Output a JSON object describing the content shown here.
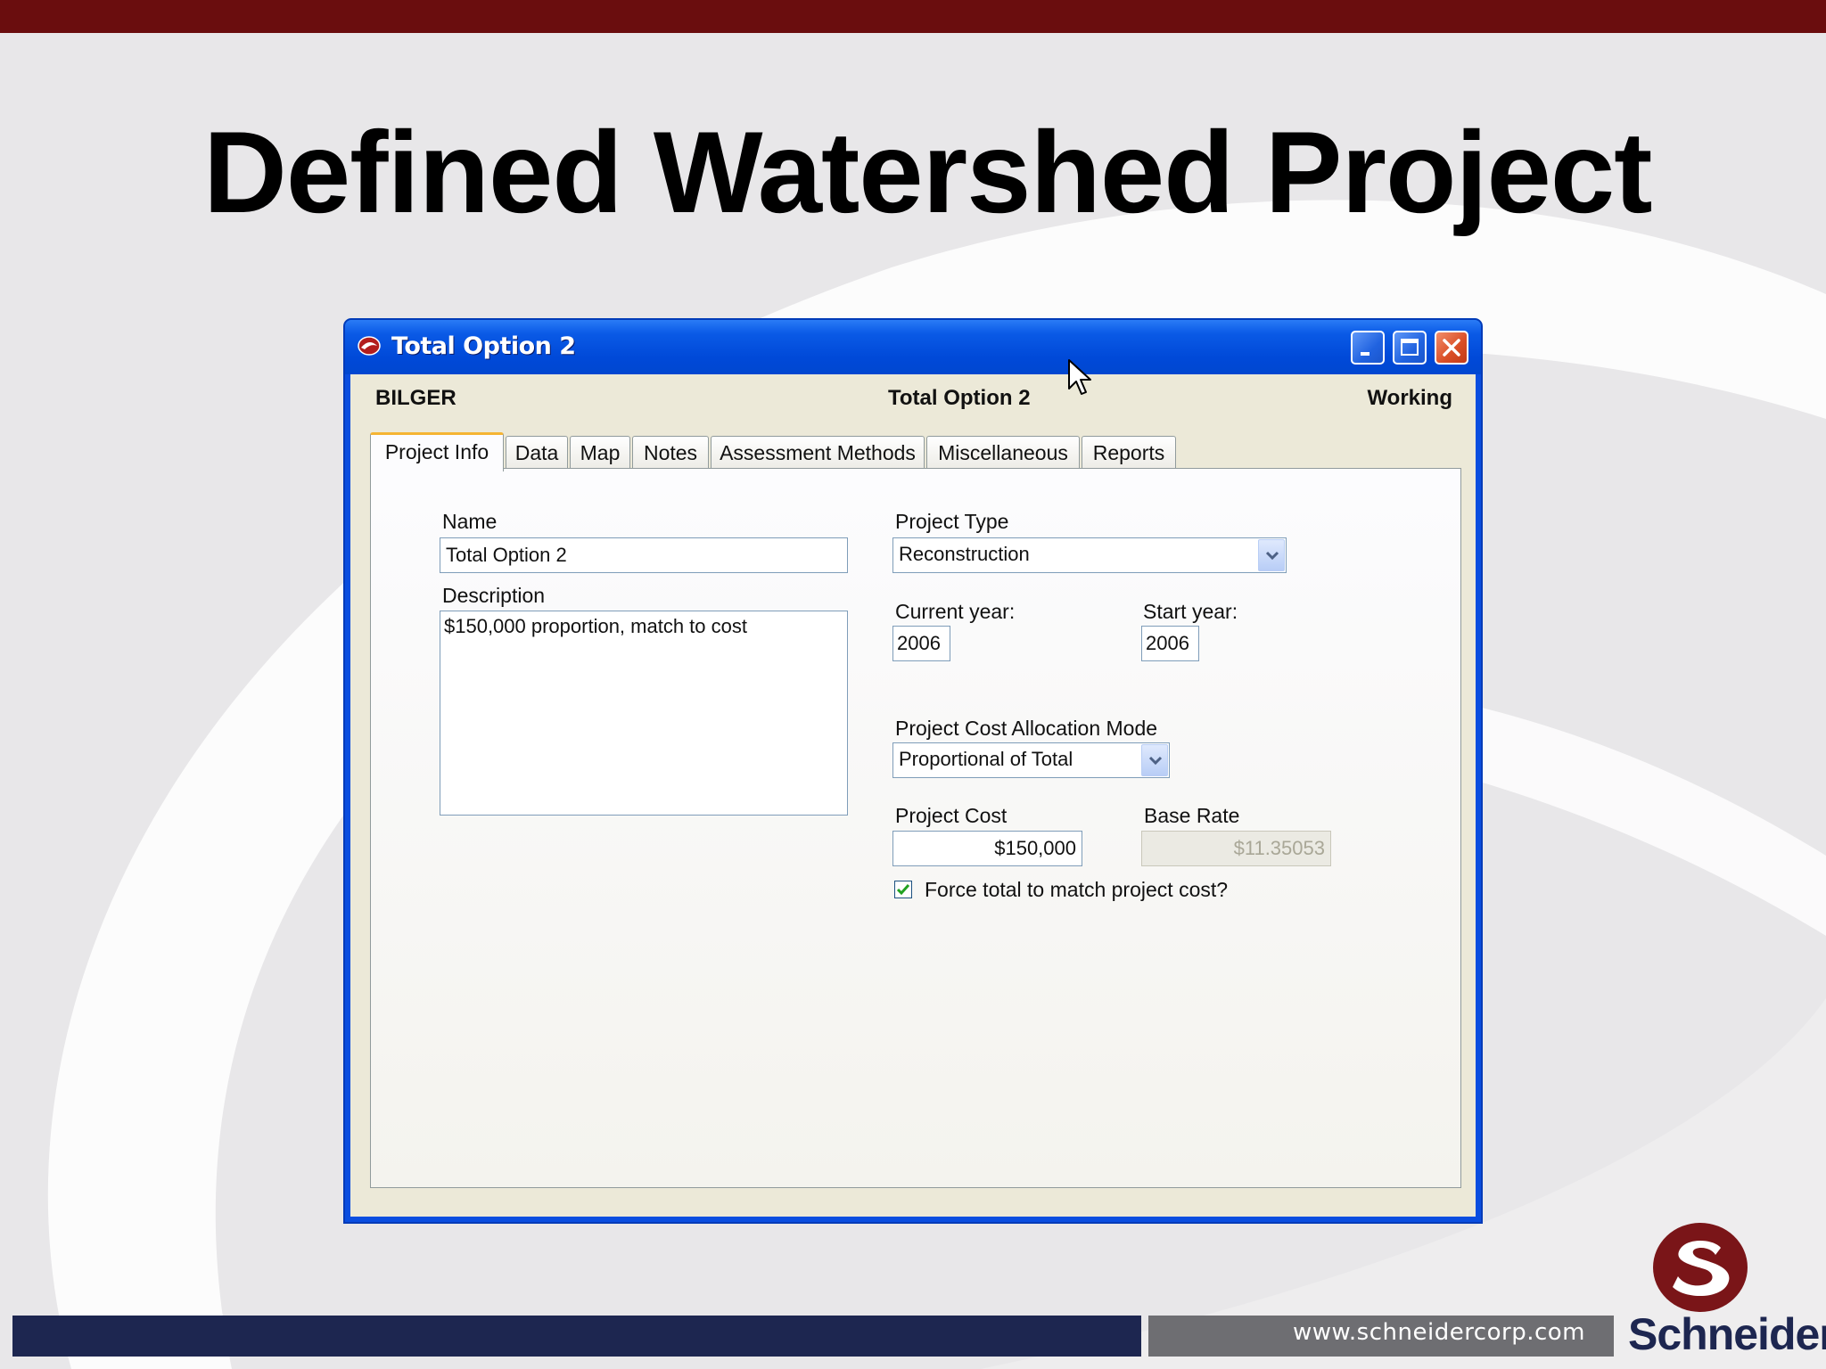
{
  "slide": {
    "title": "Defined Watershed Project",
    "website": "www.schneidercorp.com",
    "logo_text": "Schneider",
    "colors": {
      "top_bar": "#6a0d0e",
      "bottom_navy": "#1d2650",
      "bottom_gray": "#6e6e72",
      "logo_red": "#7a1518"
    }
  },
  "window": {
    "title": "Total Option 2",
    "icon": "app-logo-icon",
    "controls": [
      "minimize-icon",
      "maximize-icon",
      "close-icon"
    ],
    "colors": {
      "titlebar": "#0a5ae6",
      "close": "#d94d25",
      "client": "#ece9d8"
    }
  },
  "header": {
    "left": "BILGER",
    "center": "Total Option 2",
    "right": "Working"
  },
  "tabs": [
    {
      "label": "Project Info",
      "active": true
    },
    {
      "label": "Data"
    },
    {
      "label": "Map"
    },
    {
      "label": "Notes"
    },
    {
      "label": "Assessment Methods"
    },
    {
      "label": "Miscellaneous"
    },
    {
      "label": "Reports"
    }
  ],
  "form": {
    "name_label": "Name",
    "name_value": "Total Option 2",
    "description_label": "Description",
    "description_value": "$150,000 proportion, match to cost",
    "project_type_label": "Project Type",
    "project_type_value": "Reconstruction",
    "current_year_label": "Current year:",
    "current_year_value": "2006",
    "start_year_label": "Start year:",
    "start_year_value": "2006",
    "allocation_label": "Project Cost Allocation Mode",
    "allocation_value": "Proportional of Total",
    "project_cost_label": "Project Cost",
    "project_cost_value": "$150,000",
    "base_rate_label": "Base Rate",
    "base_rate_value": "$11.35053",
    "force_total_label": "Force total to match project cost?",
    "force_total_checked": true
  }
}
